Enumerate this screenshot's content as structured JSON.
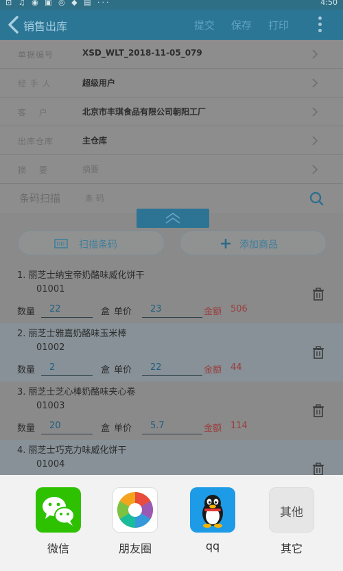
{
  "status_bar": {
    "left": "⊡ ♫ ◉ ▣ ◎ ◆ ▤ ···",
    "time": "4:50"
  },
  "header": {
    "title": "销售出库",
    "actions": {
      "submit": "提交",
      "save": "保存",
      "print": "打印"
    }
  },
  "form": {
    "doc_no": {
      "label": "单据编号",
      "value": "XSD_WLT_2018-11-05_079"
    },
    "handler": {
      "label": "经 手 人",
      "value": "超级用户"
    },
    "customer": {
      "label": "客　 户",
      "value": "北京市丰琪食品有限公司朝阳工厂"
    },
    "warehouse": {
      "label": "出库仓库",
      "value": "主仓库"
    },
    "summary": {
      "label": "摘　 要",
      "value": "摘要"
    },
    "barcode": {
      "label": "条码扫描",
      "placeholder": "条 码"
    }
  },
  "buttons": {
    "scan": "扫描条码",
    "add": "添加商品"
  },
  "items": [
    {
      "name": "1.  丽芝士纳宝帝奶酪味威化饼干",
      "code": "01001",
      "qty_label": "数量",
      "qty": "22",
      "unit": "盒",
      "price_label": "单价",
      "price": "23",
      "amount_label": "金额",
      "amount": "506"
    },
    {
      "name": "2.  丽芝士雅嘉奶酪味玉米棒",
      "code": "01002",
      "qty_label": "数量",
      "qty": "2",
      "unit": "盒",
      "price_label": "单价",
      "price": "22",
      "amount_label": "金额",
      "amount": "44"
    },
    {
      "name": "3.  丽芝士芝心棒奶酪味夹心卷",
      "code": "01003",
      "qty_label": "数量",
      "qty": "20",
      "unit": "盒",
      "price_label": "单价",
      "price": "5.7",
      "amount_label": "金额",
      "amount": "114"
    },
    {
      "name": "4.  丽芝士巧克力味威化饼干",
      "code": "01004"
    }
  ],
  "share_sheet": {
    "apps": [
      {
        "label": "微信",
        "icon": "wechat-icon"
      },
      {
        "label": "朋友圈",
        "icon": "moments-icon"
      },
      {
        "label": "qq",
        "icon": "qq-penguin-icon"
      },
      {
        "label": "其它",
        "icon": "other-icon",
        "icon_text": "其他"
      }
    ]
  },
  "colors": {
    "primary": "#2b7595",
    "overlay": "#8a8a8a",
    "amount": "#9b3d3d",
    "sheet_bg": "#f2f2f2"
  }
}
